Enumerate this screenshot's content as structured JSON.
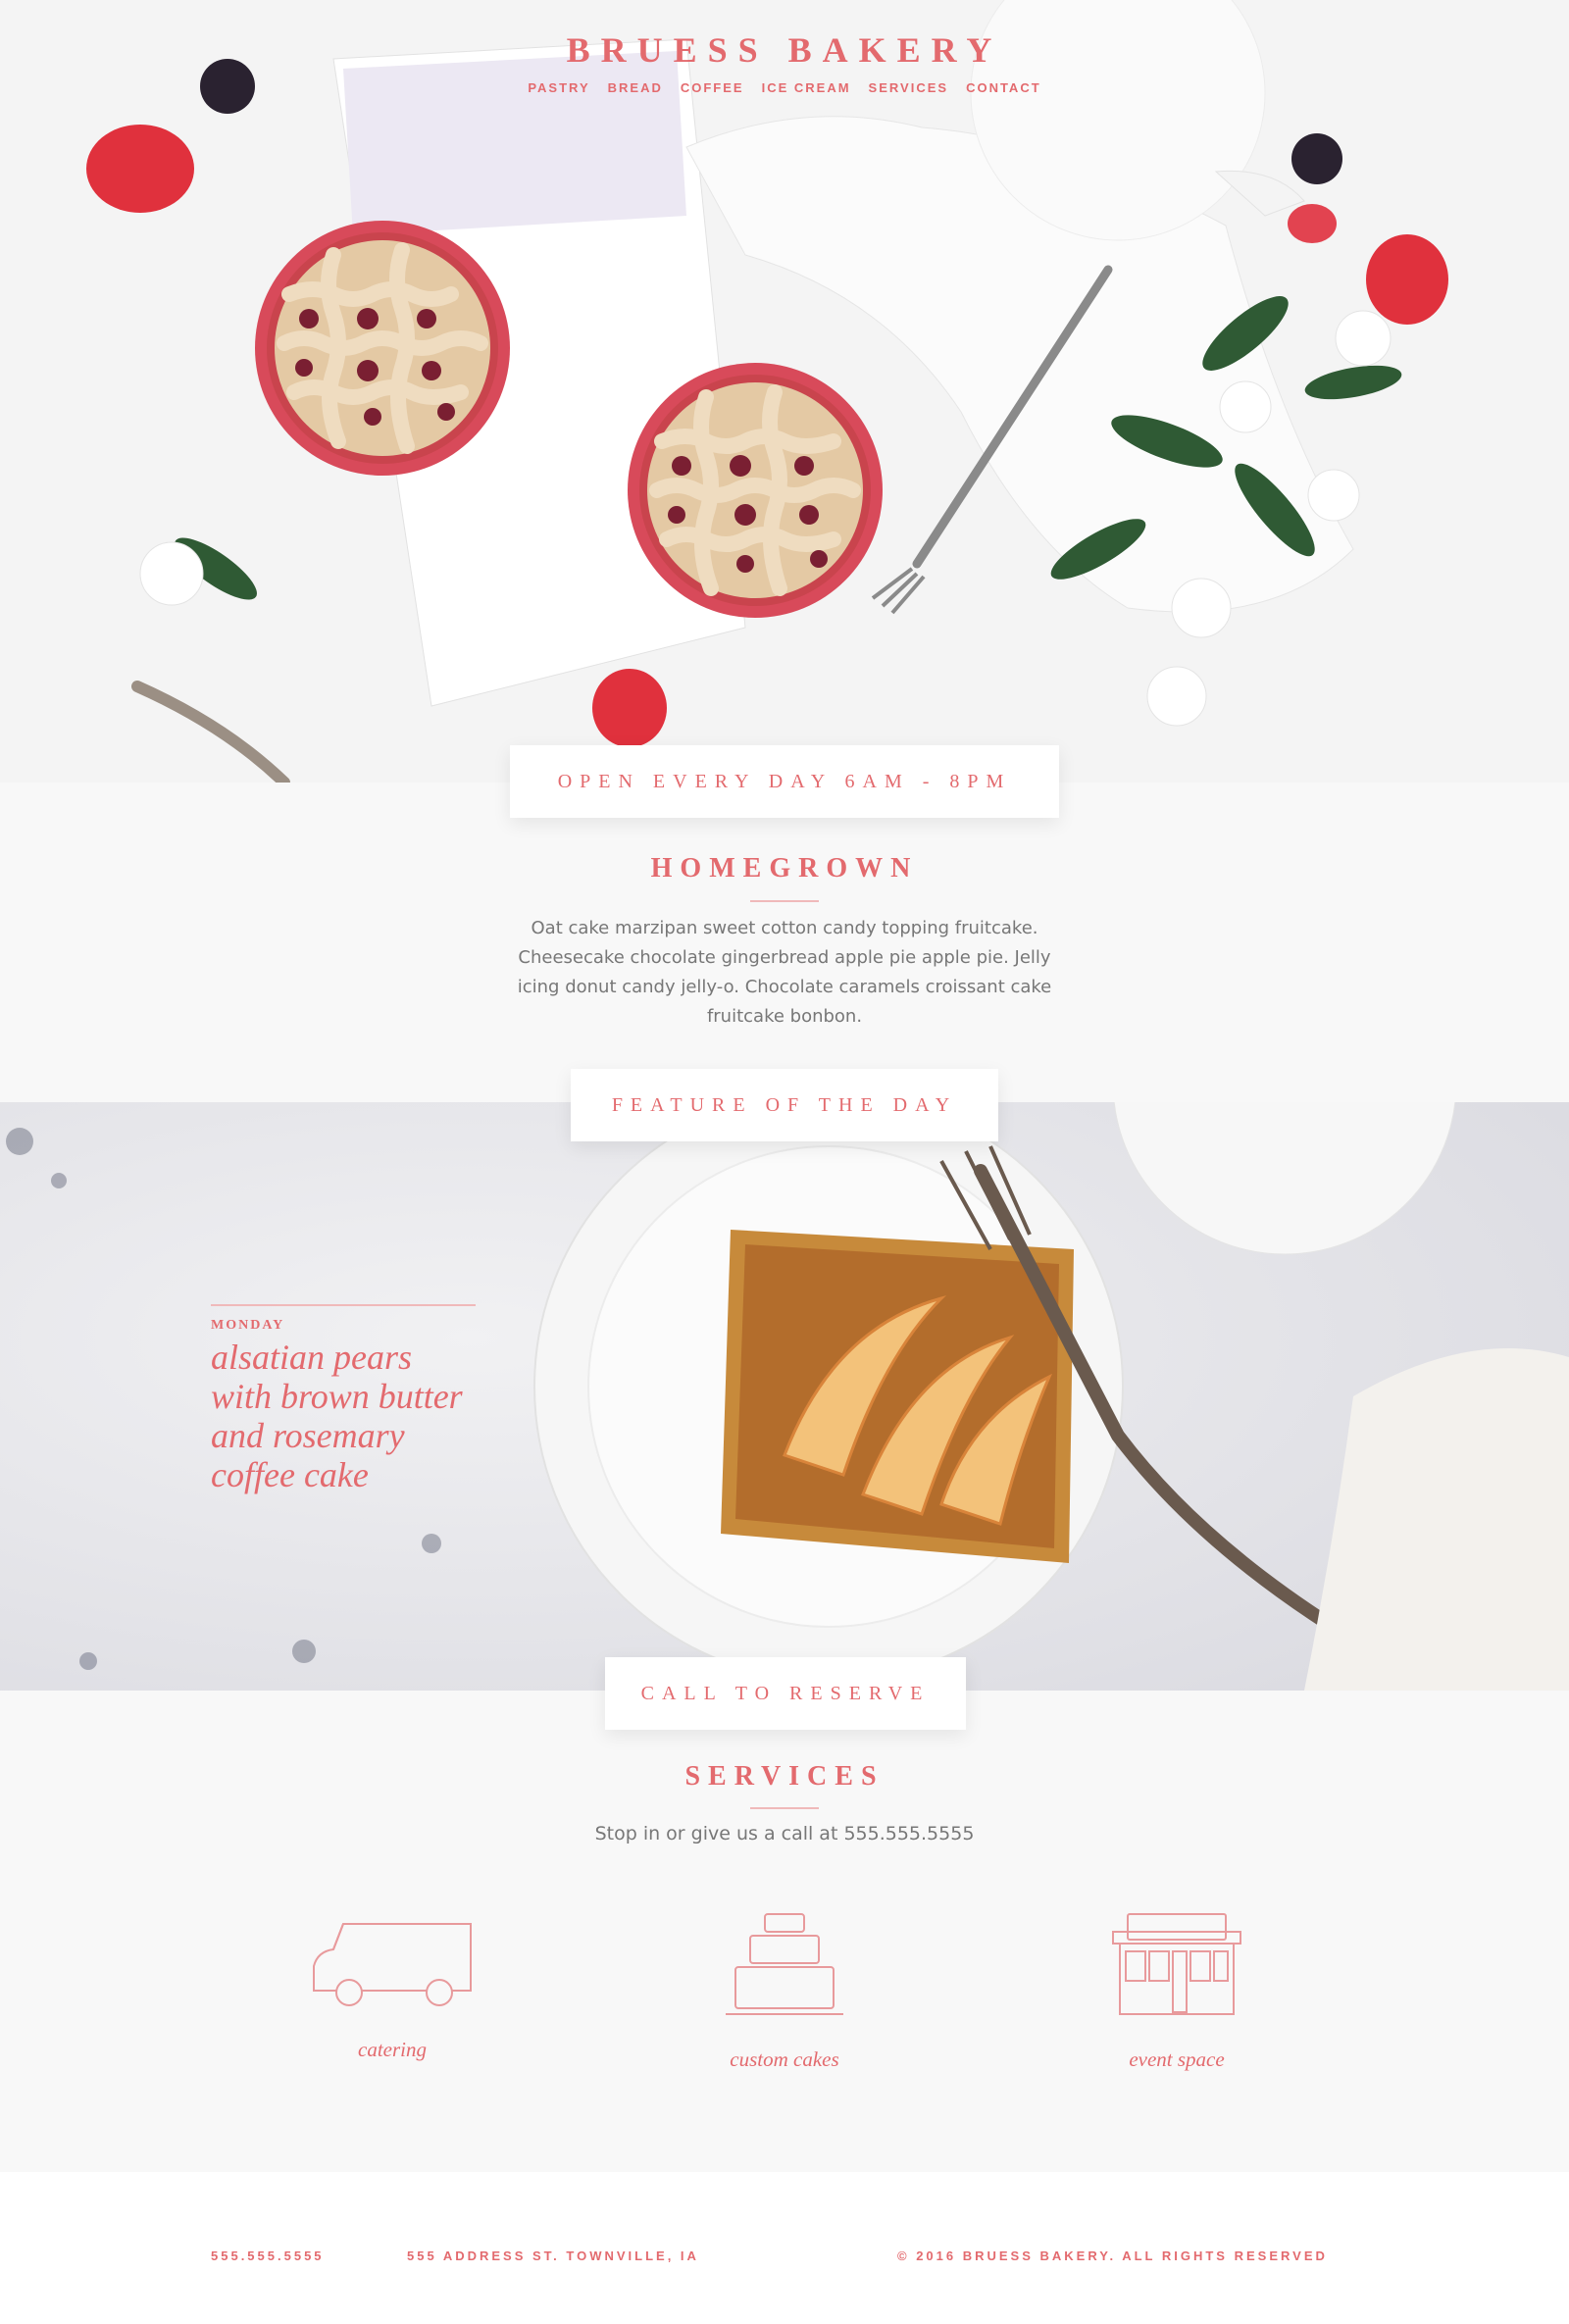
{
  "brand": {
    "name": "BRUESS BAKERY"
  },
  "nav": {
    "items": [
      "PASTRY",
      "BREAD",
      "COFFEE",
      "ICE CREAM",
      "SERVICES",
      "CONTACT"
    ]
  },
  "hours": {
    "text": "OPEN EVERY DAY 6AM - 8PM"
  },
  "homegrown": {
    "title": "HOMEGROWN",
    "body": "Oat cake marzipan sweet cotton candy topping fruitcake. Cheesecake chocolate gingerbread apple pie apple pie. Jelly icing donut candy jelly-o. Chocolate caramels croissant cake fruitcake bonbon."
  },
  "feature": {
    "tag": "FEATURE OF THE DAY",
    "day": "MONDAY",
    "name": "alsatian pears with brown butter and rosemary coffee cake"
  },
  "reserve": {
    "text": "CALL TO RESERVE"
  },
  "services": {
    "title": "SERVICES",
    "subtitle": "Stop in or give us a call at 555.555.5555",
    "items": [
      {
        "label": "catering",
        "icon": "truck-icon"
      },
      {
        "label": "custom cakes",
        "icon": "cake-icon"
      },
      {
        "label": "event space",
        "icon": "storefront-icon"
      }
    ]
  },
  "footer": {
    "phone": "555.555.5555",
    "address": "555 ADDRESS ST. TOWNVILLE, IA",
    "copyright": "© 2016 BRUESS BAKERY. ALL RIGHTS RESERVED"
  },
  "colors": {
    "accent": "#e36a6e",
    "background": "#f8f8f8"
  }
}
